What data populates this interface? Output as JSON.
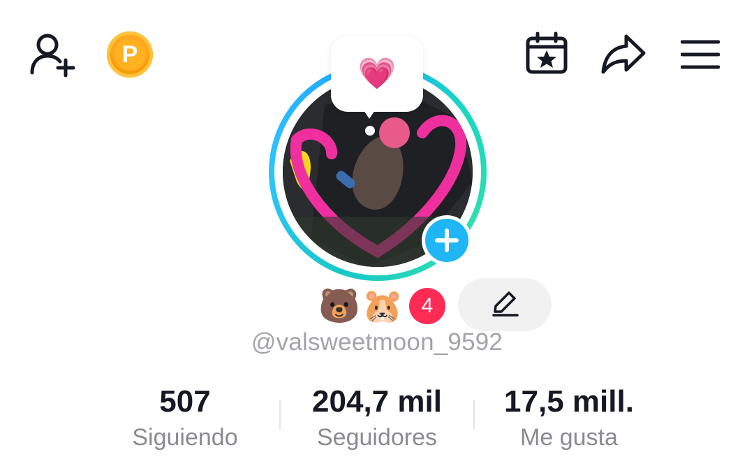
{
  "header": {
    "icons": {
      "add_friend": "person-add-icon",
      "coin": "coin-icon",
      "calendar": "calendar-star-icon",
      "share": "share-arrow-icon",
      "menu": "hamburger-menu-icon"
    },
    "coin_letter": "P"
  },
  "profile": {
    "thought_emoji": "💗",
    "badges": [
      "🐻",
      "🐹"
    ],
    "badge_count": "4",
    "username": "@valsweetmoon_9592"
  },
  "stats": [
    {
      "value": "507",
      "label": "Siguiendo"
    },
    {
      "value": "204,7 mil",
      "label": "Seguidores"
    },
    {
      "value": "17,5 mill.",
      "label": "Me gusta"
    }
  ],
  "colors": {
    "accent_red": "#fe2c55",
    "story_blue": "#20b5f4",
    "ring_teal": "#18c8c8",
    "coin_orange": "#ffa31a"
  }
}
